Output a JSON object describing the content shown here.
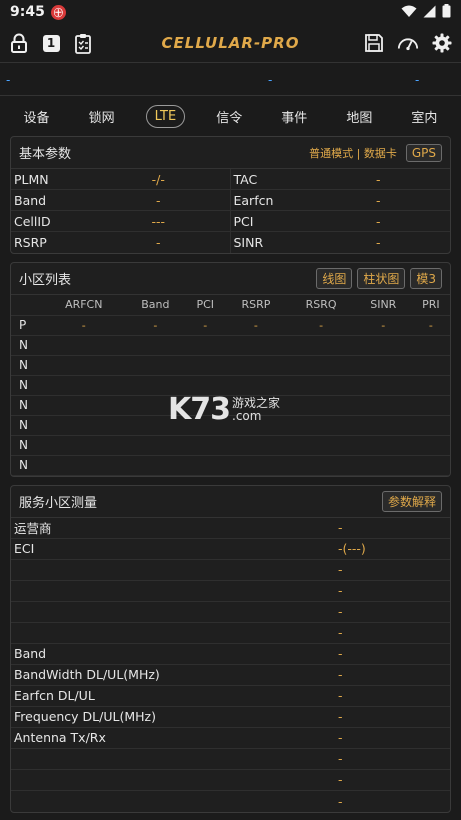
{
  "status": {
    "time": "9:45",
    "app_badge": "㊉"
  },
  "app": {
    "title": "CELLULAR-PRO",
    "tab_number": "1"
  },
  "info_line": {
    "dash_left": "-",
    "dash_mid": "-",
    "dash_right": "-"
  },
  "tabs": [
    "设备",
    "锁网",
    "LTE",
    "信令",
    "事件",
    "地图",
    "室内"
  ],
  "basic": {
    "title": "基本参数",
    "mode": "普通模式 | 数据卡",
    "gps": "GPS",
    "rows": [
      {
        "l1": "PLMN",
        "v1": "-/-",
        "l2": "TAC",
        "v2": "-"
      },
      {
        "l1": "Band",
        "v1": "-",
        "l2": "Earfcn",
        "v2": "-"
      },
      {
        "l1": "CellID",
        "v1": "---",
        "l2": "PCI",
        "v2": "-"
      },
      {
        "l1": "RSRP",
        "v1": "-",
        "l2": "SINR",
        "v2": "-"
      }
    ]
  },
  "cells": {
    "title": "小区列表",
    "btn_line": "线图",
    "btn_bar": "柱状图",
    "btn_mode": "模3",
    "headers": [
      "",
      "ARFCN",
      "Band",
      "PCI",
      "RSRP",
      "RSRQ",
      "SINR",
      "PRI"
    ],
    "rows": [
      [
        "P",
        "-",
        "-",
        "-",
        "-",
        "-",
        "-",
        "-"
      ],
      [
        "N",
        "",
        "",
        "",
        "",
        "",
        "",
        ""
      ],
      [
        "N",
        "",
        "",
        "",
        "",
        "",
        "",
        ""
      ],
      [
        "N",
        "",
        "",
        "",
        "",
        "",
        "",
        ""
      ],
      [
        "N",
        "",
        "",
        "",
        "",
        "",
        "",
        ""
      ],
      [
        "N",
        "",
        "",
        "",
        "",
        "",
        "",
        ""
      ],
      [
        "N",
        "",
        "",
        "",
        "",
        "",
        "",
        ""
      ],
      [
        "N",
        "",
        "",
        "",
        "",
        "",
        "",
        ""
      ]
    ]
  },
  "serving": {
    "title": "服务小区测量",
    "explain": "参数解释",
    "rows": [
      {
        "label": "运营商",
        "value": "-"
      },
      {
        "label": "ECI",
        "value": "-(---)"
      },
      {
        "label": "",
        "value": "-"
      },
      {
        "label": "",
        "value": "-"
      },
      {
        "label": "",
        "value": "-"
      },
      {
        "label": "",
        "value": "-"
      },
      {
        "label": "Band",
        "value": "-"
      },
      {
        "label": "BandWidth DL/UL(MHz)",
        "value": "-"
      },
      {
        "label": "Earfcn DL/UL",
        "value": "-"
      },
      {
        "label": "Frequency DL/UL(MHz)",
        "value": "-"
      },
      {
        "label": "Antenna Tx/Rx",
        "value": "-"
      },
      {
        "label": "",
        "value": "-"
      },
      {
        "label": "",
        "value": "-"
      },
      {
        "label": "",
        "value": "-"
      }
    ]
  },
  "watermark": {
    "brand": "K73",
    "line1": "游戏之家",
    "line2": ".com"
  },
  "colors": {
    "accent": "#e0a94a",
    "active_tab": "#f0c85a",
    "background": "#1b1b1b",
    "info_dash": "#4aa3ff"
  }
}
